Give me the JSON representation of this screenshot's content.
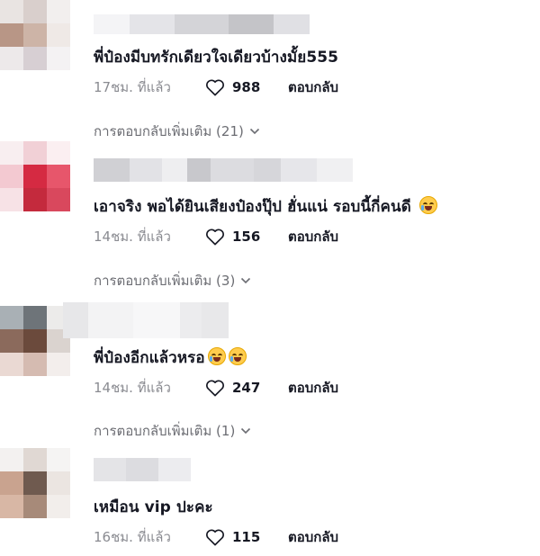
{
  "comments": [
    {
      "text": "พี่ป๋องมีบทรักเดียวใจเดียวบ้างมั้ย555",
      "time": "17ชม. ที่แล้ว",
      "likes": "988",
      "reply_label": "ตอบกลับ",
      "more_replies": "การตอบกลับเพิ่มเติม (21)",
      "emoji_count": 0
    },
    {
      "text": "เอาจริง พอได้ยินเสียงป๋องปุ๊ป ฮั่นแน่ รอบนี้กี่คนดี",
      "time": "14ชม. ที่แล้ว",
      "likes": "156",
      "reply_label": "ตอบกลับ",
      "more_replies": "การตอบกลับเพิ่มเติม (3)",
      "emoji_count": 1
    },
    {
      "text": "พี่ป๋องอีกแล้วหรอ",
      "time": "14ชม. ที่แล้ว",
      "likes": "247",
      "reply_label": "ตอบกลับ",
      "more_replies": "การตอบกลับเพิ่มเติม (1)",
      "emoji_count": 2
    },
    {
      "text": "เหมือน vip ปะคะ",
      "time": "16ชม. ที่แล้ว",
      "likes": "115",
      "reply_label": "ตอบกลับ",
      "emoji_count": 0
    }
  ],
  "icons": {
    "like": "heart-outline-icon",
    "expand": "chevron-down-icon",
    "emoji": "face-with-tears-of-joy-emoji"
  }
}
